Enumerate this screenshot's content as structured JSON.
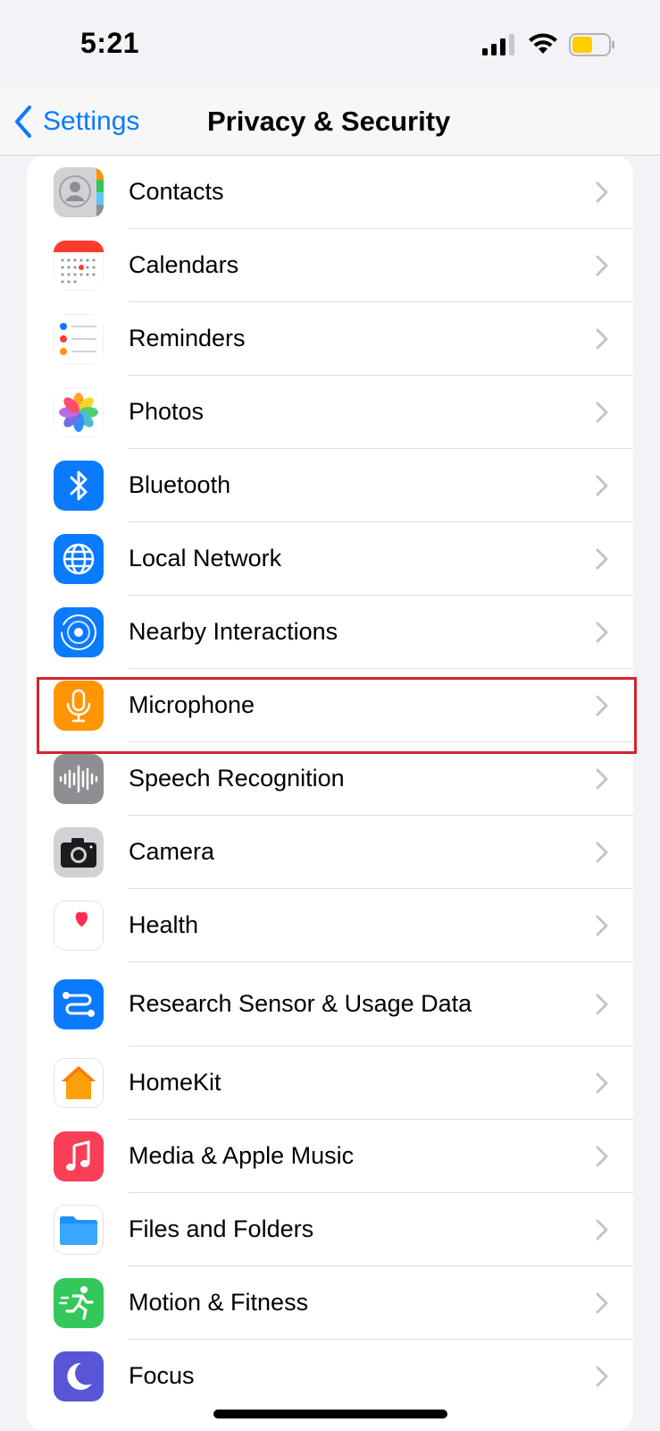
{
  "status_bar": {
    "time": "5:21",
    "signal_icon": "cellular-signal-icon",
    "wifi_icon": "wifi-icon",
    "battery_icon": "battery-icon",
    "battery_color": "#ffcc00"
  },
  "nav": {
    "back_label": "Settings",
    "title": "Privacy & Security",
    "accent": "#0a7aff"
  },
  "items": [
    {
      "label": "Contacts",
      "icon": "contacts-icon"
    },
    {
      "label": "Calendars",
      "icon": "calendar-icon"
    },
    {
      "label": "Reminders",
      "icon": "reminders-icon"
    },
    {
      "label": "Photos",
      "icon": "photos-icon"
    },
    {
      "label": "Bluetooth",
      "icon": "bluetooth-icon"
    },
    {
      "label": "Local Network",
      "icon": "globe-icon"
    },
    {
      "label": "Nearby Interactions",
      "icon": "nearby-interactions-icon"
    },
    {
      "label": "Microphone",
      "icon": "microphone-icon",
      "highlighted": true
    },
    {
      "label": "Speech Recognition",
      "icon": "waveform-icon"
    },
    {
      "label": "Camera",
      "icon": "camera-icon"
    },
    {
      "label": "Health",
      "icon": "heart-icon"
    },
    {
      "label": "Research Sensor & Usage Data",
      "icon": "research-icon"
    },
    {
      "label": "HomeKit",
      "icon": "home-icon"
    },
    {
      "label": "Media & Apple Music",
      "icon": "music-note-icon"
    },
    {
      "label": "Files and Folders",
      "icon": "folder-icon"
    },
    {
      "label": "Motion & Fitness",
      "icon": "running-figure-icon"
    },
    {
      "label": "Focus",
      "icon": "moon-icon"
    }
  ],
  "highlight_color": "#d22630"
}
